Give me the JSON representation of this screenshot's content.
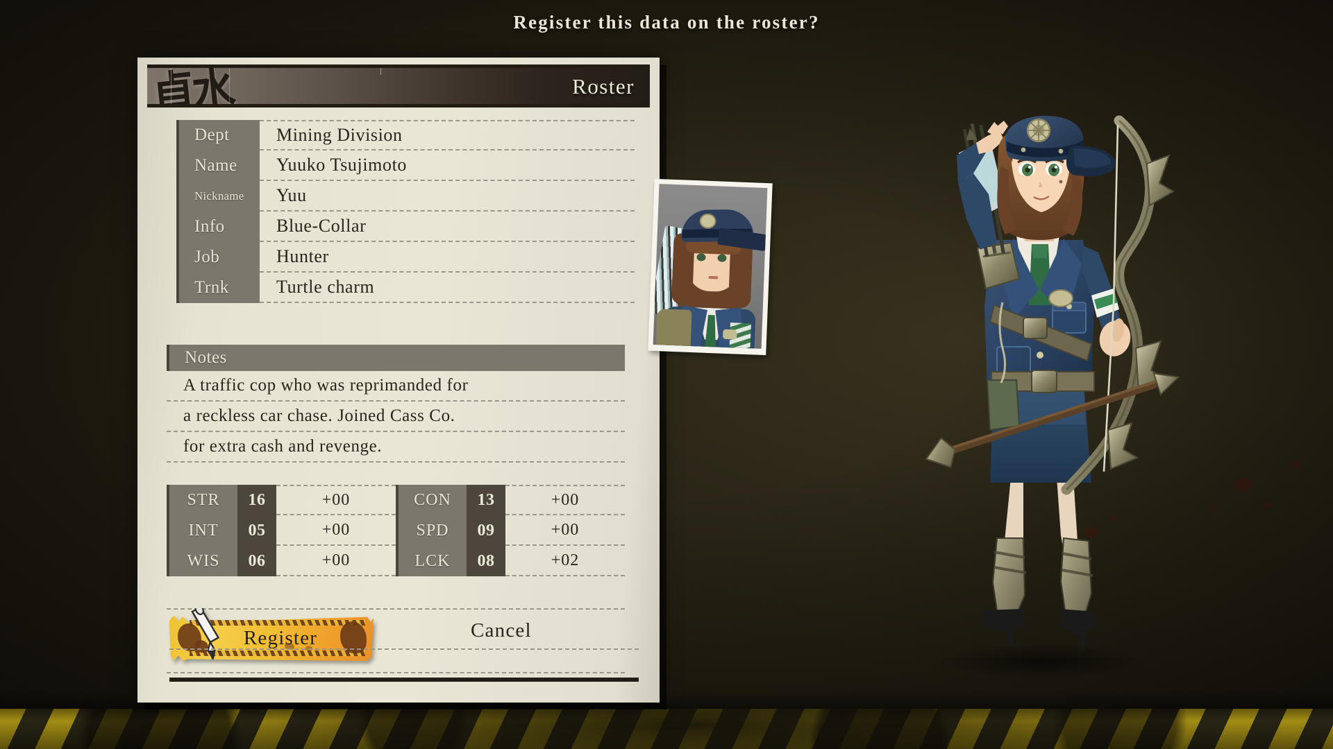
{
  "prompt": {
    "title": "Register this data on the roster?"
  },
  "panel": {
    "header_title": "Roster",
    "header_stamp": "貞水"
  },
  "info": {
    "rows": [
      {
        "label": "Dept",
        "value": "Mining Division",
        "small": false
      },
      {
        "label": "Name",
        "value": "Yuuko Tsujimoto",
        "small": false
      },
      {
        "label": "Nickname",
        "value": "Yuu",
        "small": true
      },
      {
        "label": "Info",
        "value": "Blue-Collar",
        "small": false
      },
      {
        "label": "Job",
        "value": "Hunter",
        "small": false
      },
      {
        "label": "Trnk",
        "value": "Turtle charm",
        "small": false
      }
    ]
  },
  "notes": {
    "header": "Notes",
    "lines": [
      "A traffic cop who was reprimanded for",
      "a reckless car chase. Joined Cass Co.",
      "for extra cash and revenge."
    ]
  },
  "stats": {
    "left": [
      {
        "name": "STR",
        "value": "16",
        "bonus": "+00"
      },
      {
        "name": "INT",
        "value": "05",
        "bonus": "+00"
      },
      {
        "name": "WIS",
        "value": "06",
        "bonus": "+00"
      }
    ],
    "right": [
      {
        "name": "CON",
        "value": "13",
        "bonus": "+00"
      },
      {
        "name": "SPD",
        "value": "09",
        "bonus": "+00"
      },
      {
        "name": "LCK",
        "value": "08",
        "bonus": "+02"
      }
    ]
  },
  "buttons": {
    "register": "Register",
    "cancel": "Cancel"
  },
  "colors": {
    "background": "#282314",
    "panel": "#e7e3d3",
    "label_bar": "#7b776d",
    "stat_value_bg": "#4d463c",
    "register_accent": "#f2bf35",
    "hazard_yellow": "#b9a018",
    "text_dark": "#2a241c",
    "text_light": "#e8e4d5"
  }
}
